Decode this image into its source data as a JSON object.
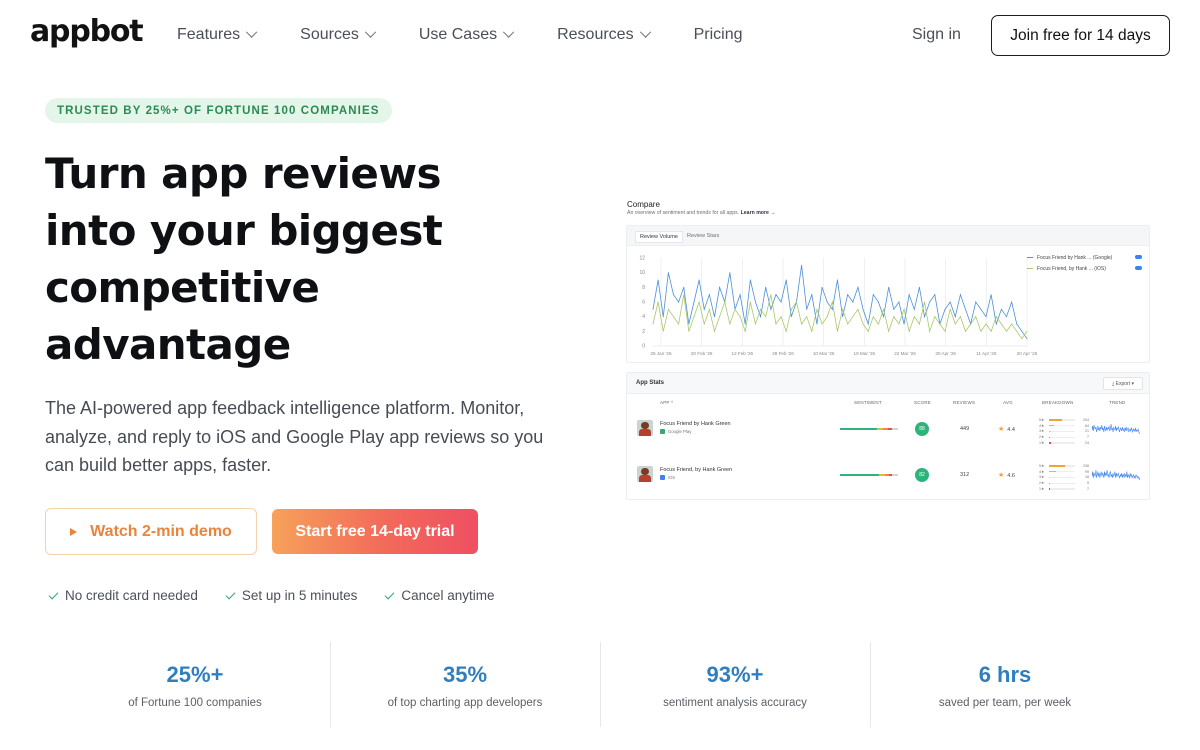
{
  "header": {
    "logo": "appbot",
    "nav": [
      {
        "label": "Features",
        "has_dropdown": true
      },
      {
        "label": "Sources",
        "has_dropdown": true
      },
      {
        "label": "Use Cases",
        "has_dropdown": true
      },
      {
        "label": "Resources",
        "has_dropdown": true
      },
      {
        "label": "Pricing",
        "has_dropdown": false
      }
    ],
    "sign_in": "Sign in",
    "join_button": "Join free for 14 days"
  },
  "hero": {
    "badge": "TRUSTED BY 25%+ OF FORTUNE 100 COMPANIES",
    "headline_lines": [
      "Turn app reviews",
      "into your biggest",
      "competitive",
      "advantage"
    ],
    "subtext": "The AI-powered app feedback intelligence platform. Monitor, analyze, and reply to iOS and Google Play app reviews so you can build better apps, faster.",
    "demo_button": "Watch 2-min demo",
    "trial_button": "Start free 14-day trial",
    "checks": [
      "No credit card needed",
      "Set up in 5 minutes",
      "Cancel anytime"
    ]
  },
  "stats": [
    {
      "value": "25%+",
      "caption": "of Fortune 100 companies"
    },
    {
      "value": "35%",
      "caption": "of top charting app developers"
    },
    {
      "value": "93%+",
      "caption": "sentiment analysis accuracy"
    },
    {
      "value": "6 hrs",
      "caption": "saved per team, per week"
    }
  ],
  "dashboard": {
    "title": "Compare",
    "subtitle": "An overview of sentiment and trends for all apps.",
    "learn_more": "Learn more →",
    "tabs": [
      "Review Volume",
      "Review Stars"
    ],
    "legend": [
      {
        "label": "Focus Friend by Hank ... (Google)",
        "color": "#4a90d9"
      },
      {
        "label": "Focus Friend, by Hank ... (iOS)",
        "color": "#a8c86a"
      }
    ],
    "app_stats": {
      "title": "App Stats",
      "export": "Export",
      "columns": [
        "APP ^",
        "SENTIMENT",
        "SCORE",
        "REVIEWS",
        "AVG",
        "BREAKDOWN",
        "TREND"
      ],
      "rows": [
        {
          "name": "Focus Friend by Hank Green",
          "source": "Google Play",
          "source_color": "#3aa76d",
          "score": "88",
          "reviews": "449",
          "avg": "4.4",
          "breakdown": [
            {
              "label": "5★",
              "value": "204",
              "frac": 0.5
            },
            {
              "label": "4★",
              "value": "64",
              "frac": 0.18
            },
            {
              "label": "3★",
              "value": "21",
              "frac": 0.06
            },
            {
              "label": "2★",
              "value": "7",
              "frac": 0.02
            },
            {
              "label": "1★",
              "value": "24",
              "frac": 0.07
            }
          ]
        },
        {
          "name": "Focus Friend, by Hank Green",
          "source": "iOS",
          "source_color": "#3b82f6",
          "score": "82",
          "reviews": "312",
          "avg": "4.6",
          "breakdown": [
            {
              "label": "5★",
              "value": "236",
              "frac": 0.6
            },
            {
              "label": "4★",
              "value": "99",
              "frac": 0.25
            },
            {
              "label": "3★",
              "value": "18",
              "frac": 0.05
            },
            {
              "label": "2★",
              "value": "5",
              "frac": 0.02
            },
            {
              "label": "1★",
              "value": "7",
              "frac": 0.02
            }
          ]
        }
      ]
    }
  },
  "chart_data": {
    "type": "line",
    "title": "",
    "xlabel": "",
    "ylabel": "",
    "ylim": [
      0,
      12
    ],
    "yticks": [
      "0",
      "2",
      "4",
      "6",
      "8",
      "10",
      "12"
    ],
    "xticks": [
      "25 Jan '26",
      "20 Feb '26",
      "12 Feb '26",
      "28 Feb '26",
      "10 Mar '26",
      "19 Mar '26",
      "22 Mar '26",
      "30 Apr '26",
      "11 Apr '26",
      "20 Apr '26"
    ],
    "series": [
      {
        "name": "Focus Friend by Hank ... (Google)",
        "color": "#4a90d9",
        "values": [
          5,
          9,
          4,
          10,
          7,
          6,
          8,
          3,
          6,
          9,
          5,
          7,
          4,
          8,
          6,
          10,
          5,
          7,
          3,
          9,
          6,
          4,
          8,
          5,
          7,
          6,
          9,
          4,
          6,
          11,
          5,
          7,
          3,
          8,
          6,
          5,
          9,
          4,
          7,
          6,
          8,
          5,
          3,
          7,
          6,
          4,
          8,
          5,
          6,
          3,
          7,
          5,
          8,
          4,
          6,
          7,
          3,
          5,
          6,
          4,
          7,
          5,
          3,
          6,
          5,
          4,
          7,
          3,
          5,
          4,
          6,
          3,
          2,
          1
        ]
      },
      {
        "name": "Focus Friend, by Hank ... (iOS)",
        "color": "#a8c86a",
        "values": [
          3,
          6,
          2,
          5,
          4,
          3,
          7,
          2,
          4,
          6,
          3,
          5,
          2,
          4,
          6,
          3,
          5,
          4,
          2,
          6,
          3,
          5,
          4,
          7,
          3,
          4,
          2,
          5,
          6,
          3,
          4,
          2,
          5,
          3,
          4,
          6,
          2,
          5,
          3,
          4,
          5,
          3,
          2,
          4,
          3,
          5,
          2,
          4,
          3,
          5,
          2,
          4,
          3,
          6,
          2,
          4,
          3,
          2,
          5,
          3,
          4,
          2,
          3,
          4,
          2,
          3,
          2,
          4,
          3,
          2,
          3,
          2,
          1,
          2
        ]
      }
    ]
  }
}
